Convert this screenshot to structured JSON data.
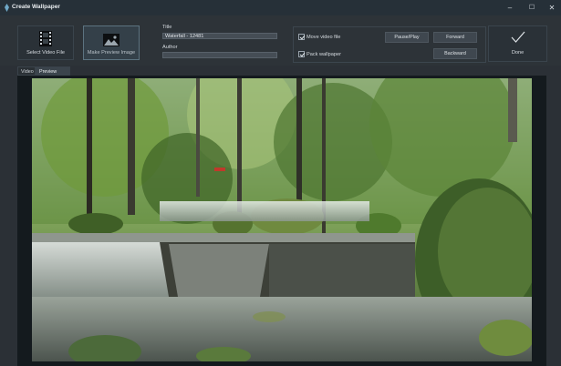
{
  "window": {
    "title": "Create Wallpaper",
    "controls": [
      "–",
      "☐",
      "✕"
    ]
  },
  "toolbar": {
    "select_video_label": "Select Video File",
    "make_preview_label": "Make Preview Image",
    "title_label": "Title",
    "title_value": "Waterfall - 12481",
    "author_label": "Author",
    "author_value": "",
    "move_video_label": "Move video file",
    "move_video_checked": true,
    "pack_wallpaper_label": "Pack wallpaper",
    "pack_wallpaper_checked": true,
    "pause_play_label": "Pause/Play",
    "forward_label": "Forward",
    "backward_label": "Backward",
    "done_label": "Done"
  },
  "tabs": [
    {
      "label": "Video",
      "selected": false
    },
    {
      "label": "Preview Image",
      "selected": true
    }
  ],
  "preview": {
    "subject": "waterfall-in-forest-photo"
  },
  "colors": {
    "window_bg": "#2b3036",
    "titlebar_bg": "#263038",
    "input_bg": "#454d55",
    "button_bg": "#3f474f",
    "preview_bg": "#141a1e"
  }
}
